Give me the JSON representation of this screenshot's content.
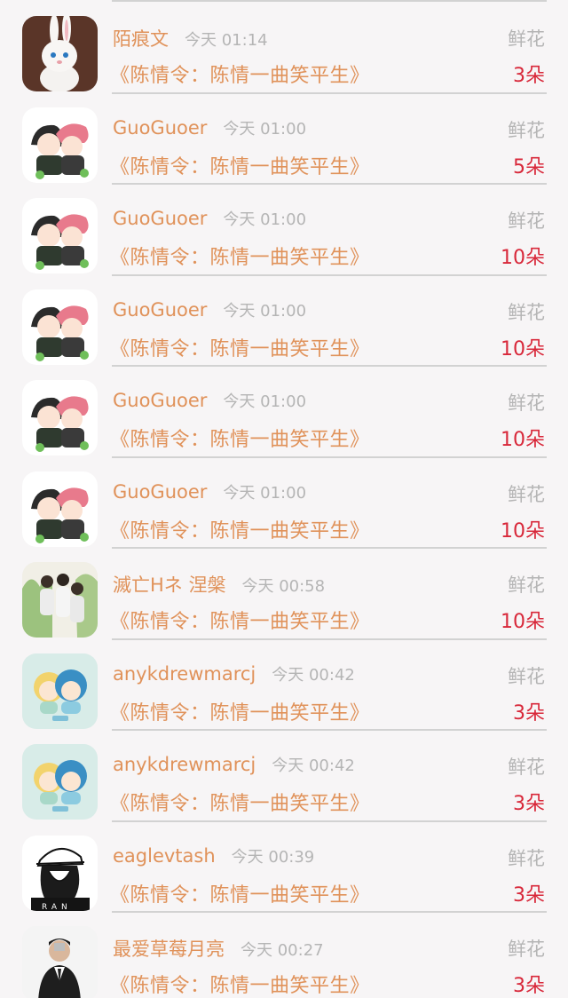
{
  "gift_list": [
    {
      "avatar": "bunny-avatar",
      "name": "陌痕文",
      "time": "今天 01:14",
      "gift": "鲜花",
      "book": "《陈情令：陈情一曲笑平生》",
      "count": "3朵"
    },
    {
      "avatar": "cartoon-couple-avatar",
      "name": "GuoGuoer",
      "time": "今天 01:00",
      "gift": "鲜花",
      "book": "《陈情令：陈情一曲笑平生》",
      "count": "5朵"
    },
    {
      "avatar": "cartoon-couple-avatar",
      "name": "GuoGuoer",
      "time": "今天 01:00",
      "gift": "鲜花",
      "book": "《陈情令：陈情一曲笑平生》",
      "count": "10朵"
    },
    {
      "avatar": "cartoon-couple-avatar",
      "name": "GuoGuoer",
      "time": "今天 01:00",
      "gift": "鲜花",
      "book": "《陈情令：陈情一曲笑平生》",
      "count": "10朵"
    },
    {
      "avatar": "cartoon-couple-avatar",
      "name": "GuoGuoer",
      "time": "今天 01:00",
      "gift": "鲜花",
      "book": "《陈情令：陈情一曲笑平生》",
      "count": "10朵"
    },
    {
      "avatar": "cartoon-couple-avatar",
      "name": "GuoGuoer",
      "time": "今天 01:00",
      "gift": "鲜花",
      "book": "《陈情令：陈情一曲笑平生》",
      "count": "10朵"
    },
    {
      "avatar": "group-photo-avatar",
      "name": "滅亡Hネ 涅槃",
      "time": "今天 00:58",
      "gift": "鲜花",
      "book": "《陈情令：陈情一曲笑平生》",
      "count": "10朵"
    },
    {
      "avatar": "chibi-pair-avatar",
      "name": "anykdrewmarcj",
      "time": "今天 00:42",
      "gift": "鲜花",
      "book": "《陈情令：陈情一曲笑平生》",
      "count": "3朵"
    },
    {
      "avatar": "chibi-pair-avatar",
      "name": "anykdrewmarcj",
      "time": "今天 00:42",
      "gift": "鲜花",
      "book": "《陈情令：陈情一曲笑平生》",
      "count": "3朵"
    },
    {
      "avatar": "sketch-boy-avatar",
      "name": "eaglevtash",
      "time": "今天 00:39",
      "gift": "鲜花",
      "book": "《陈情令：陈情一曲笑平生》",
      "count": "3朵"
    },
    {
      "avatar": "suit-man-avatar",
      "name": "最爱草莓月亮",
      "time": "今天 00:27",
      "gift": "鲜花",
      "book": "《陈情令：陈情一曲笑平生》",
      "count": "3朵"
    }
  ],
  "colors": {
    "name": "#e0925a",
    "book": "#e0925a",
    "count": "#d8283a",
    "muted": "#b5b5b5",
    "background": "#f7f5f6"
  },
  "avatar_text": {
    "sketch": "RAN"
  }
}
